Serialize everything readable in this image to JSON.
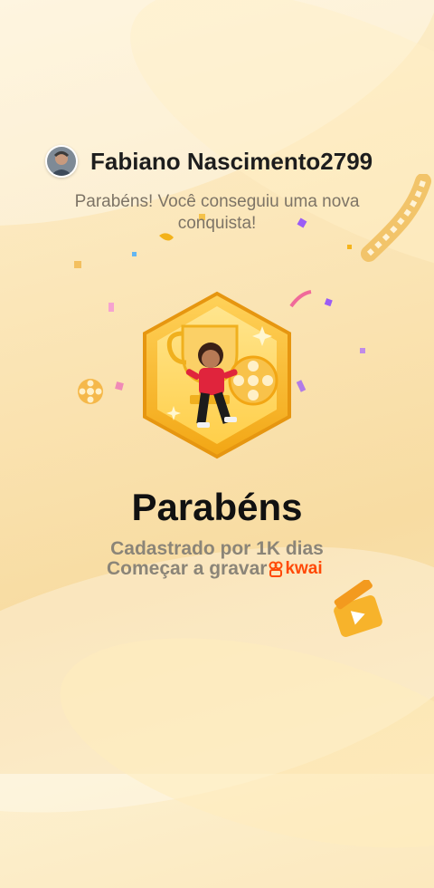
{
  "user": {
    "name": "Fabiano Nascimento2799"
  },
  "message": {
    "subtitle": "Parabéns! Você conseguiu uma nova conquista!"
  },
  "achievement": {
    "title": "Parabéns",
    "description": "Cadastrado por 1K dias",
    "cta": "Começar a gravar",
    "brand": "kwai"
  },
  "colors": {
    "accent": "#ff4906",
    "gold": "#f5b41c",
    "background": "#fbe6b8"
  },
  "icons": [
    "avatar",
    "badge-hexagon-icon",
    "trophy-icon",
    "film-reel-icon",
    "clapperboard-icon",
    "kwai-logo-icon"
  ]
}
